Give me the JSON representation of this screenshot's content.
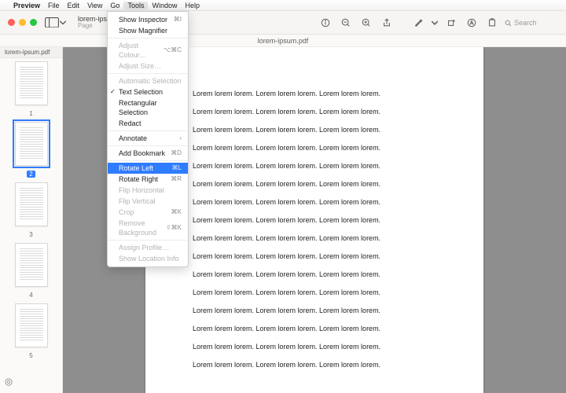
{
  "menubar": {
    "app": "Preview",
    "items": [
      "File",
      "Edit",
      "View",
      "Go",
      "Tools",
      "Window",
      "Help"
    ],
    "active_index": 4
  },
  "window": {
    "title": "lorem-ipsum",
    "subtitle": "Page",
    "filename_bar": "lorem-ipsum.pdf",
    "sidebar_filename": "lorem-ipsum.pdf",
    "search_placeholder": "Search"
  },
  "toolbar_icons": [
    "sidebar",
    "view-mode",
    "info",
    "zoom-out",
    "zoom-in",
    "share",
    "markup",
    "chevron",
    "rotate",
    "text",
    "export"
  ],
  "sidebar": {
    "pages": [
      1,
      2,
      3,
      4,
      5
    ],
    "selected_page": 2
  },
  "document": {
    "line": "Lorem lorem lorem. Lorem lorem lorem. Lorem lorem lorem.",
    "line_count": 16
  },
  "tools_menu": [
    {
      "label": "Show Inspector",
      "shortcut": "⌘I",
      "enabled": true
    },
    {
      "label": "Show Magnifier",
      "enabled": true
    },
    {
      "sep": true
    },
    {
      "label": "Adjust Colour…",
      "shortcut": "⌥⌘C",
      "enabled": false
    },
    {
      "label": "Adjust Size…",
      "enabled": false
    },
    {
      "sep": true
    },
    {
      "label": "Automatic Selection",
      "enabled": false
    },
    {
      "label": "Text Selection",
      "enabled": true,
      "checked": true
    },
    {
      "label": "Rectangular Selection",
      "enabled": true
    },
    {
      "label": "Redact",
      "enabled": true
    },
    {
      "sep": true
    },
    {
      "label": "Annotate",
      "enabled": true,
      "submenu": true
    },
    {
      "sep": true
    },
    {
      "label": "Add Bookmark",
      "shortcut": "⌘D",
      "enabled": true
    },
    {
      "sep": true
    },
    {
      "label": "Rotate Left",
      "shortcut": "⌘L",
      "enabled": true,
      "highlight": true
    },
    {
      "label": "Rotate Right",
      "shortcut": "⌘R",
      "enabled": true
    },
    {
      "label": "Flip Horizontal",
      "enabled": false
    },
    {
      "label": "Flip Vertical",
      "enabled": false
    },
    {
      "label": "Crop",
      "shortcut": "⌘K",
      "enabled": false
    },
    {
      "label": "Remove Background",
      "shortcut": "⇧⌘K",
      "enabled": false
    },
    {
      "sep": true
    },
    {
      "label": "Assign Profile…",
      "enabled": false
    },
    {
      "label": "Show Location Info",
      "enabled": false
    }
  ]
}
